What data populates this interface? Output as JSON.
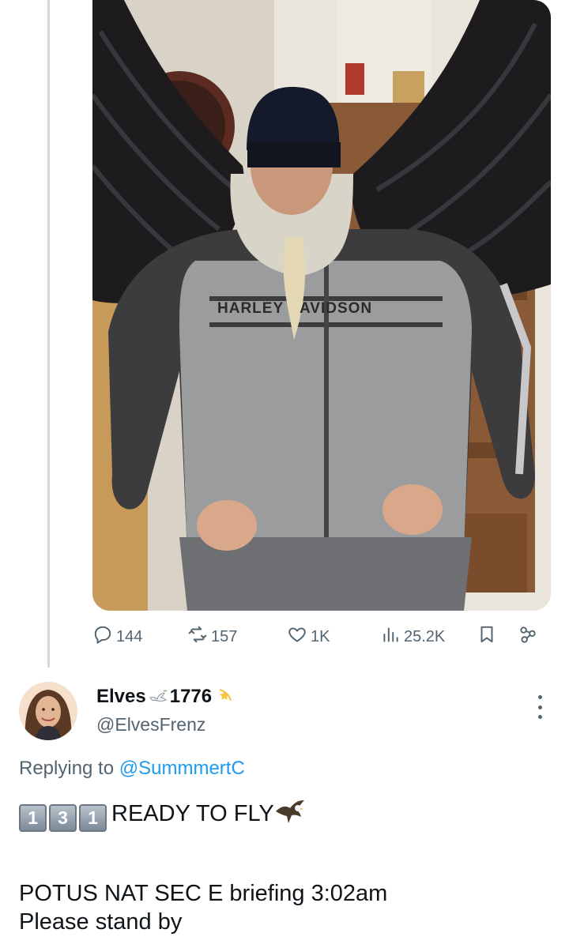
{
  "post": {
    "stats": {
      "replies": "144",
      "reposts": "157",
      "likes": "1K",
      "views": "25.2K"
    },
    "media": {
      "jacket_text_left": "HARLEY",
      "jacket_text_right": "AVIDSON"
    }
  },
  "reply": {
    "display_name_start": "Elves",
    "display_name_end": "1776",
    "handle": "@ElvesFrenz",
    "replying_label": "Replying to",
    "replying_to": "@SummmertC",
    "keycaps": [
      "1",
      "3",
      "1"
    ],
    "line1_text": "READY TO FLY",
    "line2": "POTUS NAT SEC E briefing 3:02am",
    "line3": "Please stand by"
  },
  "icons": [
    "reply-icon",
    "repost-icon",
    "like-icon",
    "views-icon",
    "bookmark-icon",
    "share-icon",
    "dove-icon",
    "shooting-star-icon",
    "eagle-icon",
    "more-icon"
  ],
  "colors": {
    "accent": "#1d9bf0",
    "muted": "#536471",
    "text": "#0f1419",
    "thread_line": "#cfd9de"
  }
}
